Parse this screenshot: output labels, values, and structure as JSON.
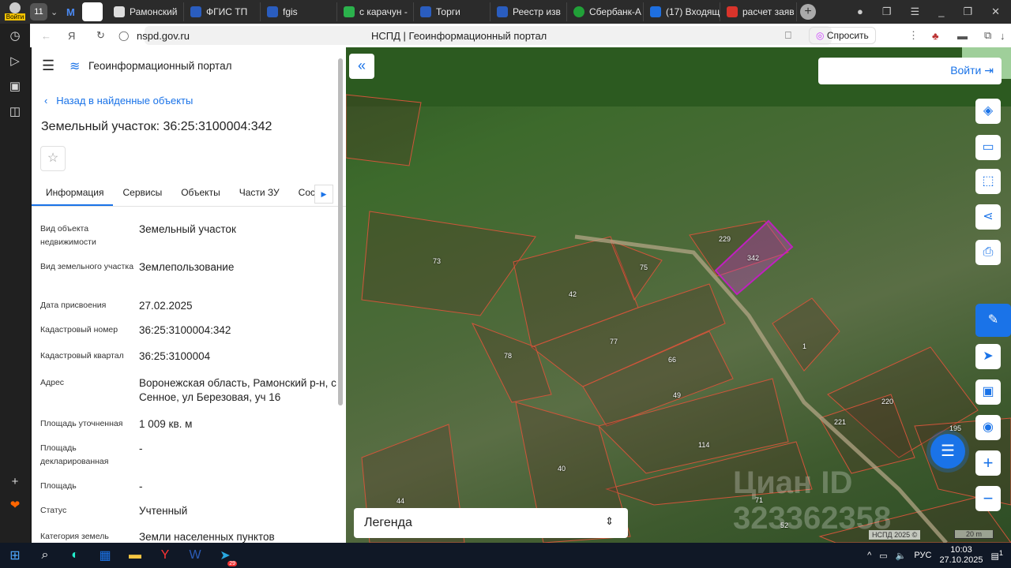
{
  "browser": {
    "profile_label": "Войти",
    "tab_count": "11",
    "tabs": [
      "Рамонский",
      "ФГИС ТП",
      "fgis",
      "с карачун -",
      "Торги",
      "Реестр изв",
      "Сбербанк-А",
      "(17) Входящ",
      "расчет заяв"
    ],
    "url": "nspd.gov.ru",
    "page_title": "НСПД | Геоинформационный портал",
    "ask_label": "Спросить"
  },
  "panel": {
    "portal_title": "Геоинформационный портал",
    "back_label": "Назад в найденные объекты",
    "object_title": "Земельный участок: 36:25:3100004:342",
    "tabs": [
      "Информация",
      "Сервисы",
      "Объекты",
      "Части ЗУ",
      "Соста"
    ],
    "fields": [
      {
        "k": "Вид объекта недвижимости",
        "v": "Земельный участок"
      },
      {
        "k": "Вид земельного участка",
        "v": "Землепользование"
      },
      {
        "k": "Дата присвоения",
        "v": "27.02.2025"
      },
      {
        "k": "Кадастровый номер",
        "v": "36:25:3100004:342"
      },
      {
        "k": "Кадастровый квартал",
        "v": "36:25:3100004"
      },
      {
        "k": "Адрес",
        "v": "Воронежская область, Рамонский р-н, с Сенное, ул Березовая, уч 16"
      },
      {
        "k": "Площадь уточненная",
        "v": "1 009 кв. м"
      },
      {
        "k": "Площадь декларированная",
        "v": "-"
      },
      {
        "k": "Площадь",
        "v": "-"
      },
      {
        "k": "Статус",
        "v": "Учтенный"
      },
      {
        "k": "Категория земель",
        "v": "Земли населенных пунктов"
      }
    ]
  },
  "map": {
    "login_label": "Войти",
    "legend_label": "Легенда",
    "attribution": "НСПД 2025 ©",
    "scale": "20 m",
    "watermark": "Циан ID 323362358",
    "parcels": [
      "73",
      "75",
      "42",
      "77",
      "78",
      "66",
      "49",
      "114",
      "40",
      "44",
      "71",
      "52",
      "229",
      "342",
      "1",
      "220",
      "221",
      "195"
    ]
  },
  "taskbar": {
    "lang": "РУС",
    "time": "10:03",
    "date": "27.10.2025",
    "notif_count": "1",
    "yandex_badge": "29"
  }
}
